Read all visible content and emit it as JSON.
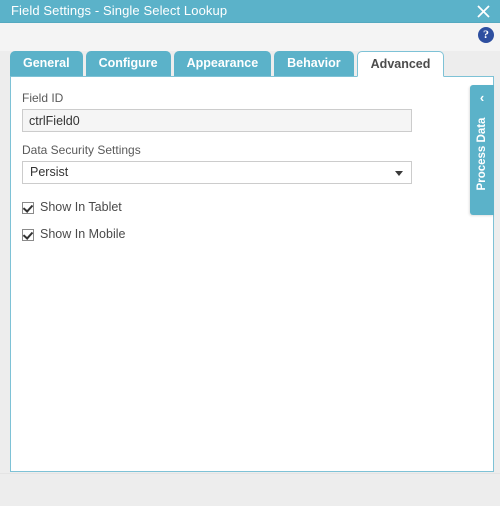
{
  "window": {
    "title": "Field Settings - Single Select Lookup",
    "close_icon": "close-icon",
    "help_icon": "help-question-icon"
  },
  "tabs": [
    {
      "label": "General",
      "active": false
    },
    {
      "label": "Configure",
      "active": false
    },
    {
      "label": "Appearance",
      "active": false
    },
    {
      "label": "Behavior",
      "active": false
    },
    {
      "label": "Advanced",
      "active": true
    }
  ],
  "form": {
    "field_id": {
      "label": "Field ID",
      "value": "ctrlField0",
      "placeholder": ""
    },
    "data_security": {
      "label": "Data Security Settings",
      "value": "Persist",
      "options": [
        "Persist"
      ]
    },
    "checkboxes": [
      {
        "label": "Show In Tablet",
        "checked": true
      },
      {
        "label": "Show In Mobile",
        "checked": true
      }
    ]
  },
  "side_panel": {
    "label": "Process Data",
    "chevron": "‹"
  },
  "colors": {
    "accent": "#5bb2c9",
    "tab_border": "#7ec2d6",
    "help_badge": "#2e4fa0",
    "input_bg": "#f5f5f5",
    "input_border": "#cccccc"
  }
}
